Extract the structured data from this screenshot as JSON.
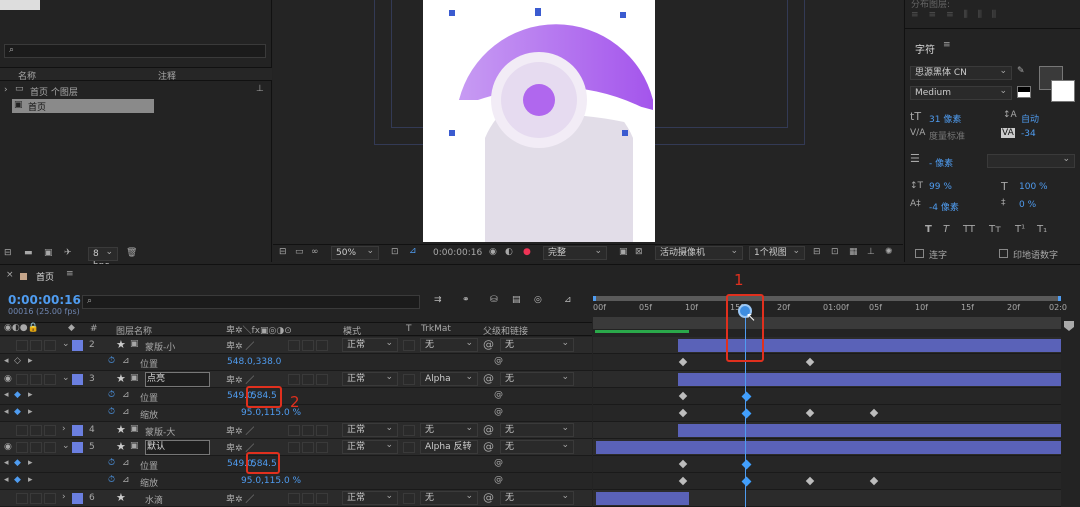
{
  "project": {
    "columns": [
      "名称",
      "注释"
    ],
    "folder": "首页 个图层",
    "item": "首页",
    "bpc": "8 bpc"
  },
  "viewer": {
    "zoom": "50%",
    "timecode": "0:00:00:16",
    "quality": "完整",
    "camera": "活动摄像机",
    "views": "1个视图"
  },
  "character": {
    "panel_top": "分布图层:",
    "title": "字符",
    "font": "思源黑体 CN",
    "style": "Medium",
    "size": "31 像素",
    "leading": "自动",
    "kerning": "度量标准",
    "tracking": "-34",
    "stroke": "- 像素",
    "vscale": "99 %",
    "hscale": "100 %",
    "baseline": "-4 像素",
    "tsume": "0 %",
    "ligature": "连字",
    "hindi": "印地语数字",
    "styles": [
      "T",
      "T",
      "TT",
      "Tт",
      "T¹",
      "T₁"
    ]
  },
  "timeline": {
    "comp_name": "首页",
    "timecode": "0:00:00:16",
    "fps": "00016 (25.00 fps)",
    "headers": {
      "layer_name": "图层名称",
      "mode": "模式",
      "t": "T",
      "trkmat": "TrkMat",
      "parent": "父级和链接"
    },
    "ruler": [
      "00f",
      "05f",
      "10f",
      "15f",
      "20f",
      "01:00f",
      "05f",
      "10f",
      "15f",
      "20f",
      "02:0"
    ],
    "layers": [
      {
        "num": "2",
        "name": "蒙版-小",
        "mode": "正常",
        "trk": "无",
        "parent": "无",
        "color": "#6b7fe0"
      },
      {
        "num": "3",
        "name": "点亮",
        "mode": "正常",
        "trk": "Alpha",
        "parent": "无",
        "color": "#6b7fe0"
      },
      {
        "num": "4",
        "name": "蒙版-大",
        "mode": "正常",
        "trk": "无",
        "parent": "无",
        "color": "#6b7fe0"
      },
      {
        "num": "5",
        "name": "默认",
        "mode": "正常",
        "trk": "Alpha 反转",
        "parent": "无",
        "color": "#6b7fe0"
      },
      {
        "num": "6",
        "name": "水滴",
        "mode": "正常",
        "trk": "无",
        "parent": "无",
        "color": "#6b7fe0"
      }
    ],
    "props": {
      "position": "位置",
      "scale": "缩放",
      "pos_l2": "548.0,338.0",
      "pos_l3_a": "549.0,",
      "pos_l3_b": "584.5",
      "scale_l3": "95.0,115.0 %",
      "pos_l5_a": "549.0,",
      "pos_l5_b": "584.5",
      "scale_l5": "95.0,115.0 %"
    },
    "annotation_1": "1",
    "annotation_2": "2"
  },
  "colors": {
    "accent": "#4f9cf0",
    "annotation": "#e0301e",
    "layer_bar": "#5a62b8",
    "purple": "#b26bf0"
  }
}
